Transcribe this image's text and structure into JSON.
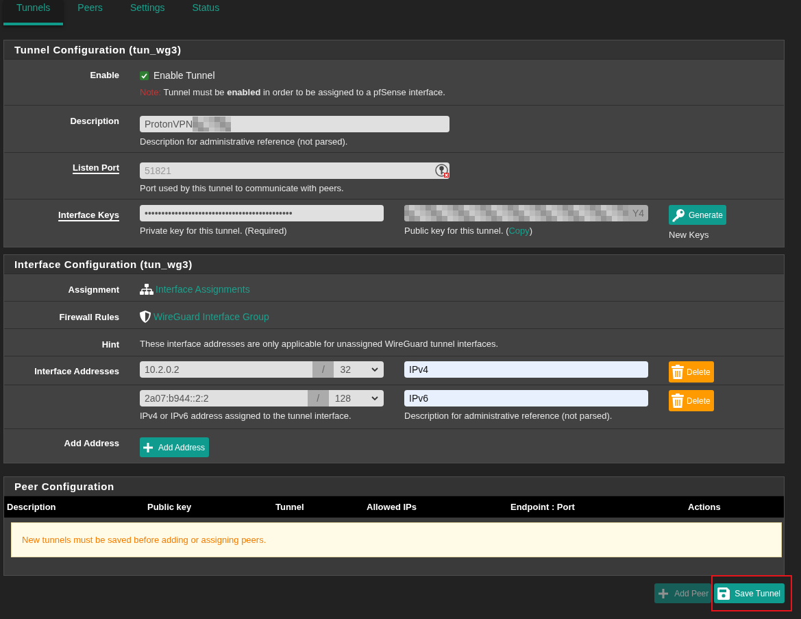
{
  "tabs": [
    {
      "label": "Tunnels",
      "selected": true
    },
    {
      "label": "Peers",
      "selected": false
    },
    {
      "label": "Settings",
      "selected": false
    },
    {
      "label": "Status",
      "selected": false
    }
  ],
  "tunnel_configuration": {
    "title": "Tunnel Configuration (tun_wg3)",
    "enable": {
      "label": "Enable",
      "label_link": false,
      "checkbox_label": "Enable Tunnel",
      "checked": true,
      "note_label": "Note:",
      "note": "Tunnel must be **enabled** in order to be assigned to a pfSense interface."
    },
    "description": {
      "label": "Description",
      "label_link": false,
      "value": "ProtonVPN",
      "redacted": true,
      "hint": "Description for administrative reference (not parsed)."
    },
    "listen_port": {
      "label": "Listen Port",
      "label_link": true,
      "placeholder": "51821",
      "hint": "Port used by this tunnel to communicate with peers."
    },
    "interface_keys": {
      "label": "Interface Keys",
      "label_link": true,
      "private_key": "••••••••••••••••••••••••••••••••••••••••••••",
      "private_hint": "Private key for this tunnel. (Required)",
      "public_key": "Y4",
      "public_redacted": true,
      "public_hint_before": "Public key for this tunnel. (",
      "public_hint_link": "Copy",
      "public_hint_after": ")",
      "generate_button": "Generate",
      "generate_caption": "New Keys"
    }
  },
  "interface_configuration": {
    "title": "Interface Configuration (tun_wg3)",
    "assignment": {
      "label": "Assignment",
      "link": "Interface Assignments"
    },
    "firewall_rules": {
      "label": "Firewall Rules",
      "link": "WireGuard Interface Group"
    },
    "hint": {
      "label": "Hint",
      "text": "These interface addresses are only applicable for unassigned WireGuard tunnel interfaces."
    },
    "addresses_label": "Interface Addresses",
    "addresses": [
      {
        "address": "10.2.0.2",
        "separator": "/",
        "prefix": "32",
        "description": "IPv4",
        "delete_button": "Delete"
      },
      {
        "address": "2a07:b944::2:2",
        "separator": "/",
        "prefix": "128",
        "description": "IPv6",
        "delete_button": "Delete"
      }
    ],
    "address_hint": "IPv4 or IPv6 address assigned to the tunnel interface.",
    "description_hint": "Description for administrative reference (not parsed).",
    "add_address": {
      "label": "Add Address",
      "button": "Add Address"
    }
  },
  "peer_configuration": {
    "title": "Peer Configuration",
    "columns": [
      "Description",
      "Public key",
      "Tunnel",
      "Allowed IPs",
      "Endpoint : Port",
      "Actions"
    ],
    "notice": "New tunnels must be saved before adding or assigning peers."
  },
  "footer_buttons": [
    {
      "label": "Add Peer",
      "kind": "add",
      "disabled": true,
      "highlighted": false
    },
    {
      "label": "Save Tunnel",
      "kind": "save",
      "disabled": false,
      "highlighted": true
    }
  ]
}
